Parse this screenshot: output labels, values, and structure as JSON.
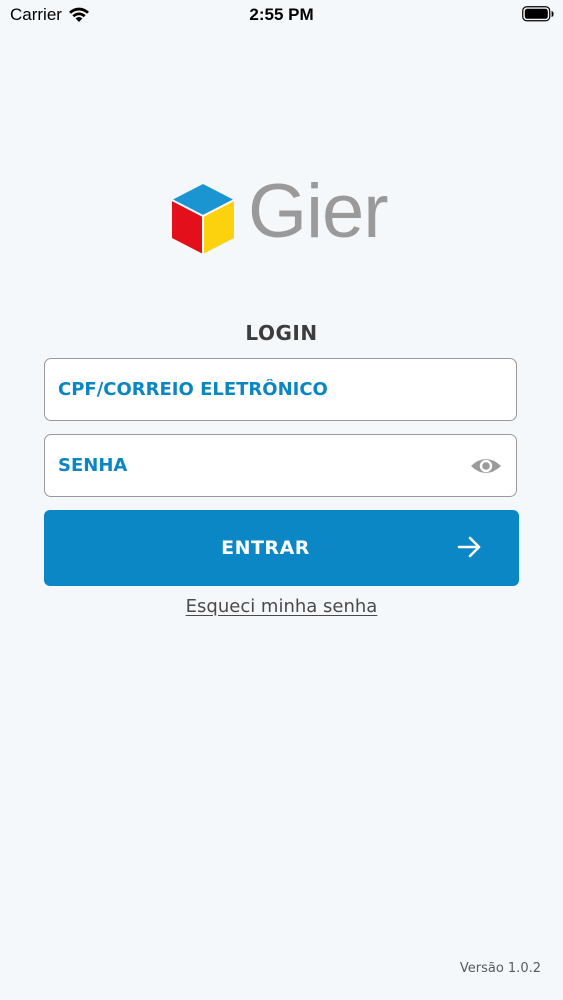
{
  "status_bar": {
    "carrier": "Carrier",
    "time": "2:55 PM",
    "wifi_icon": "wifi-icon",
    "battery_icon": "battery-full-icon"
  },
  "brand": {
    "name": "Gier",
    "logo_icon": "cube-logo-icon",
    "colors": {
      "cube_top": "#1a95d2",
      "cube_left": "#e3101b",
      "cube_right": "#fbd20d",
      "wordmark": "#9a9a9a"
    }
  },
  "login": {
    "title": "LOGIN",
    "username": {
      "placeholder": "CPF/CORREIO ELETRÔNICO",
      "value": ""
    },
    "password": {
      "placeholder": "SENHA",
      "value": "",
      "toggle_icon": "eye-icon"
    },
    "submit": {
      "label": "ENTRAR",
      "icon": "arrow-right-icon"
    },
    "forgot_password": "Esqueci minha senha"
  },
  "footer": {
    "version": "Versão 1.0.2"
  },
  "colors": {
    "accent": "#0a87c4",
    "background": "#f5f8fb",
    "field_border": "#9a9a9a"
  }
}
